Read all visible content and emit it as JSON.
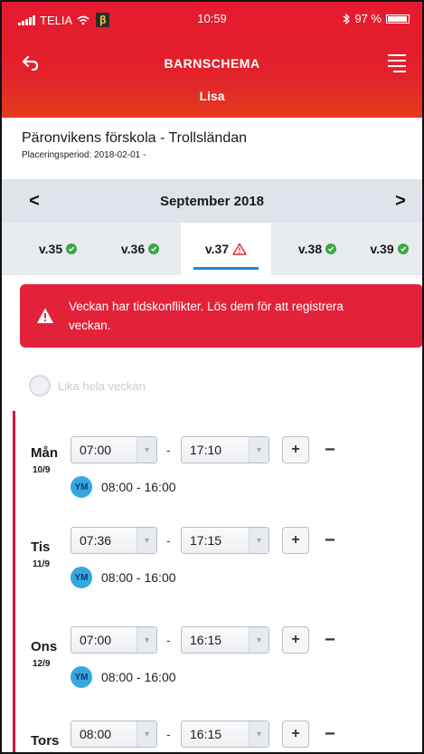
{
  "status_bar": {
    "carrier": "TELIA",
    "beta_label": "β",
    "time": "10:59",
    "battery": "97 %",
    "battery_level": 0.97
  },
  "header": {
    "title": "BARNSCHEMA",
    "child_name": "Lisa"
  },
  "school": {
    "name": "Päronvikens förskola - Trollsländan",
    "placement": "Placeringsperiod: 2018-02-01 -"
  },
  "month_nav": {
    "label": "September 2018",
    "prev": "<",
    "next": ">"
  },
  "weeks": [
    {
      "label": "v.35",
      "status": "ok"
    },
    {
      "label": "v.36",
      "status": "ok"
    },
    {
      "label": "v.37",
      "status": "conflict"
    },
    {
      "label": "v.38",
      "status": "ok"
    },
    {
      "label": "v.39",
      "status": "ok"
    }
  ],
  "alert": {
    "text": "Veckan har tidskonflikter. Lös dem för att registrera veckan."
  },
  "same_week": {
    "label": "Lika hela veckan"
  },
  "days": [
    {
      "name": "Mån",
      "date": "10/9",
      "start": "07:00",
      "end": "17:10",
      "badge": "YM",
      "schedule": "08:00 - 16:00"
    },
    {
      "name": "Tis",
      "date": "11/9",
      "start": "07:36",
      "end": "17:15",
      "badge": "YM",
      "schedule": "08:00 - 16:00"
    },
    {
      "name": "Ons",
      "date": "12/9",
      "start": "07:00",
      "end": "16:15",
      "badge": "YM",
      "schedule": "08:00 - 16:00"
    },
    {
      "name": "Tors",
      "date": "",
      "start": "08:00",
      "end": "16:15",
      "badge": "",
      "schedule": ""
    }
  ],
  "controls": {
    "dash": "-",
    "plus": "+",
    "minus": "−"
  },
  "colors": {
    "header_red": "#e3202b",
    "alert_red": "#e3223a",
    "ok_green": "#3aa845",
    "active_underline": "#1e88d8",
    "badge_blue": "#35a8e0"
  }
}
